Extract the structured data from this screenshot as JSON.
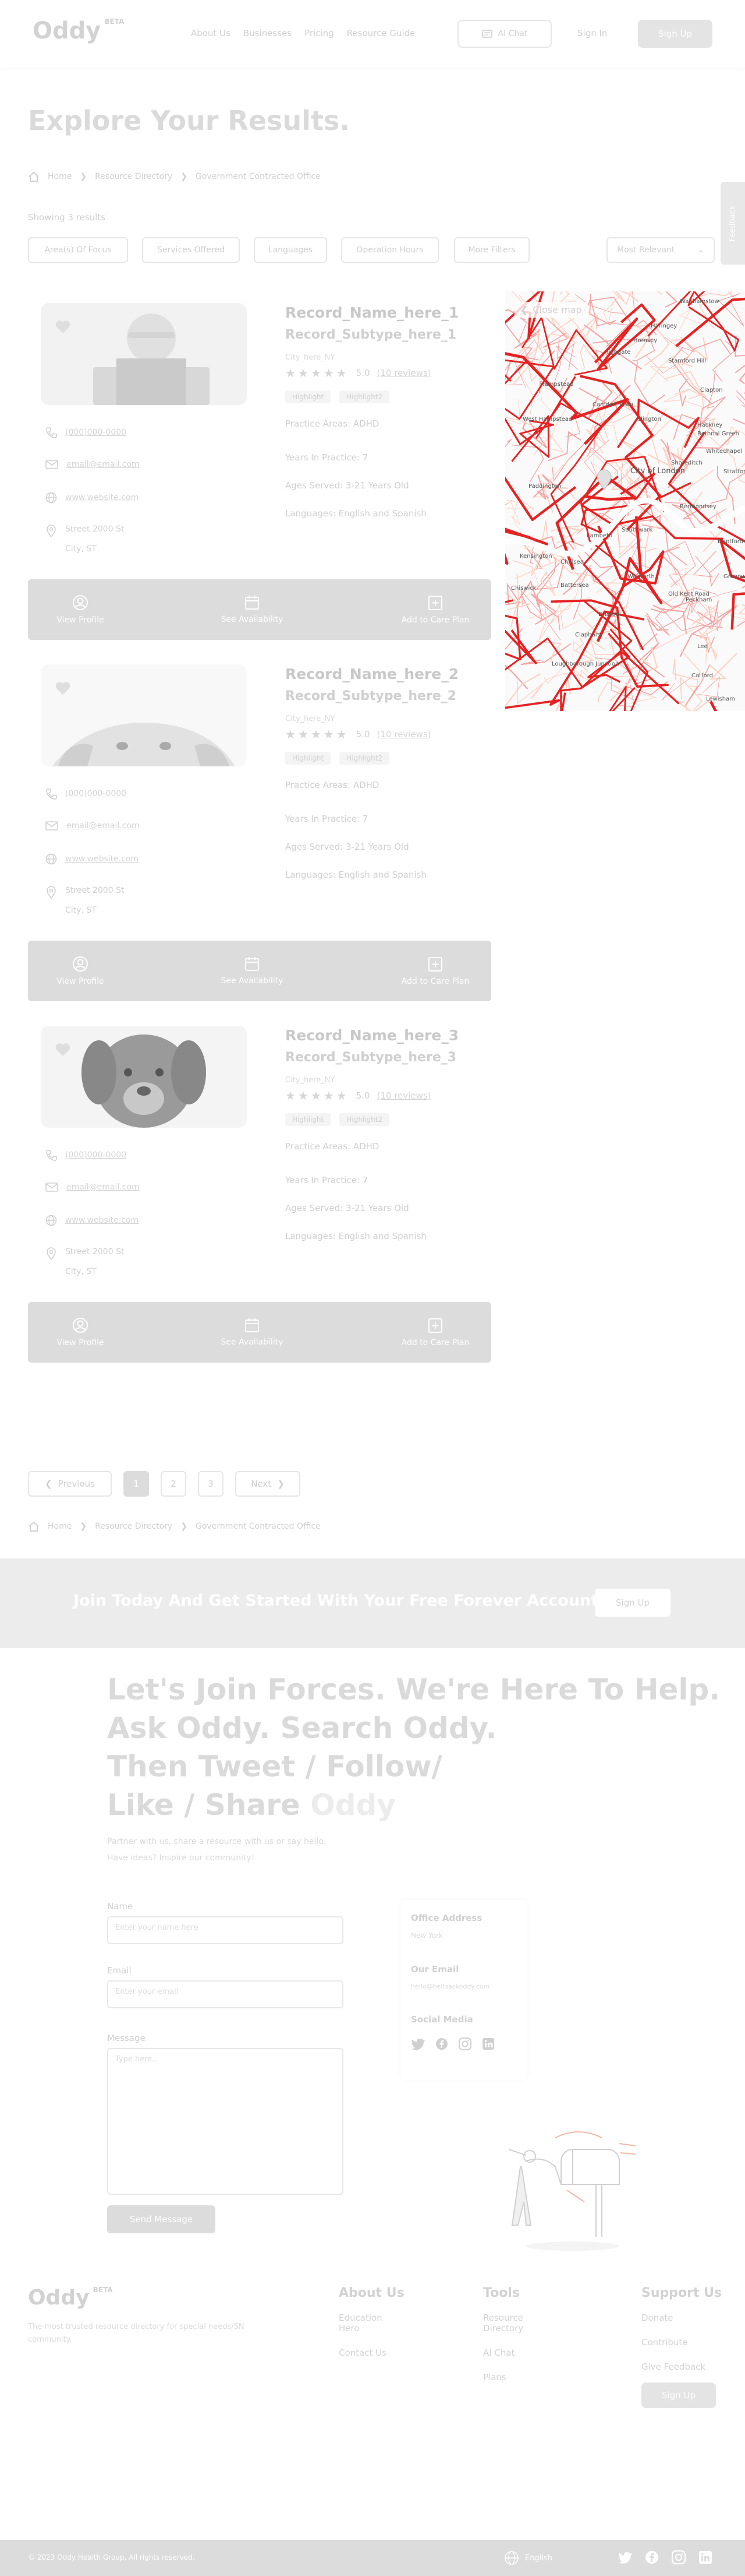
{
  "header": {
    "logo": "Oddy",
    "logo_badge": "BETA",
    "nav": [
      "About Us",
      "Businesses",
      "Pricing",
      "Resource Guide"
    ],
    "ai_chat": "AI Chat",
    "sign_in": "Sign In",
    "sign_up": "Sign Up"
  },
  "page": {
    "title": "Explore Your Results.",
    "breadcrumb": [
      "Home",
      "Resource Directory",
      "Government Contracted Office"
    ],
    "showing": "Showing 3 results",
    "filters": [
      "Area(s) Of Focus",
      "Services Offered",
      "Languages",
      "Operation Hours",
      "More Filters"
    ],
    "sort": "Most Relevant",
    "feedback_tab": "Feedback",
    "close_map": "Close map"
  },
  "map": {
    "labels": [
      "Walthamstow",
      "Haringey",
      "Hornsey",
      "Highgate",
      "Hampstead",
      "Stamford Hill",
      "West Hampstead",
      "Camden Town",
      "Islington",
      "Clapton",
      "Hackney",
      "Shoreditch",
      "Whitechapel",
      "Bethnal Green",
      "Stratford",
      "City of London",
      "Paddington",
      "Kensington",
      "Lambeth",
      "Southwark",
      "Bermondsey",
      "Greenwich",
      "Peckham",
      "Walworth",
      "Old Kent Road",
      "Brixton",
      "Clapham",
      "Battersea",
      "Chelsea",
      "Chiswick",
      "Loughborough Junction",
      "Lee",
      "Lewisham",
      "Deptford",
      "Catford"
    ]
  },
  "records": [
    {
      "name": "Record_Name_here_1",
      "subtype": "Record_Subtype_here_1",
      "city": "City_here_NY",
      "rating": "5.0",
      "reviews": "(10 reviews)",
      "tags": [
        "Highlight",
        "Highlight2"
      ],
      "practice": "Practice Areas: ADHD",
      "years": "Years In Practice: 7",
      "ages": "Ages Served: 3-21 Years Old",
      "languages": "Languages: English and Spanish",
      "phone": "(000)000-0000",
      "email": "email@email.com",
      "website": "www.website.com",
      "street": "Street 2000 St",
      "citystate": "City, ST",
      "view_profile": "View Profile",
      "availability": "See Availability",
      "care_plan": "Add to Care Plan"
    },
    {
      "name": "Record_Name_here_2",
      "subtype": "Record_Subtype_here_2",
      "city": "City_here_NY",
      "rating": "5.0",
      "reviews": "(10 reviews)",
      "tags": [
        "Highlight",
        "Highlight2"
      ],
      "practice": "Practice Areas: ADHD",
      "years": "Years In Practice: 7",
      "ages": "Ages Served: 3-21 Years Old",
      "languages": "Languages: English and Spanish",
      "phone": "(000)000-0000",
      "email": "email@email.com",
      "website": "www.website.com",
      "street": "Street 2000 St",
      "citystate": "City, ST",
      "view_profile": "View Profile",
      "availability": "See Availability",
      "care_plan": "Add to Care Plan"
    },
    {
      "name": "Record_Name_here_3",
      "subtype": "Record_Subtype_here_3",
      "city": "City_here_NY",
      "rating": "5.0",
      "reviews": "(10 reviews)",
      "tags": [
        "Highlight",
        "Highlight2"
      ],
      "practice": "Practice Areas: ADHD",
      "years": "Years In Practice: 7",
      "ages": "Ages Served: 3-21 Years Old",
      "languages": "Languages: English and Spanish",
      "phone": "(000)000-0000",
      "email": "email@email.com",
      "website": "www.website.com",
      "street": "Street 2000 St",
      "citystate": "City, ST",
      "view_profile": "View Profile",
      "availability": "See Availability",
      "care_plan": "Add to Care Plan"
    }
  ],
  "pagination": {
    "previous": "Previous",
    "pages": [
      "1",
      "2",
      "3"
    ],
    "next": "Next",
    "current": "1"
  },
  "cta": {
    "text": "Join Today And Get Started With Your Free Forever Account!",
    "button": "Sign Up"
  },
  "contact": {
    "headline": [
      "Let's Join Forces. We're Here To Help.",
      "Ask Oddy. Search Oddy.",
      "Then Tweet / Follow/",
      "Like / Share"
    ],
    "headline_accent": "Oddy",
    "sub1": "Partner with us, share a resource with us or say hello.",
    "sub2": "Have ideas? Inspire our community!",
    "name_label": "Name",
    "name_placeholder": "Enter your name here",
    "email_label": "Email",
    "email_placeholder": "Enter your email",
    "message_label": "Message",
    "message_placeholder": "Type here...",
    "send": "Send Message",
    "office_label": "Office Address",
    "office_value": "New York",
    "email_us_label": "Our Email",
    "email_us_value": "hello@helloaskoddy.com",
    "social_label": "Social Media"
  },
  "footer": {
    "logo": "Oddy",
    "badge": "BETA",
    "tagline": "The most trusted resource directory for special needs/SN community.",
    "about_title": "About Us",
    "about_links": [
      "Education Hero",
      "Contact Us"
    ],
    "tools_title": "Tools",
    "tools_links": [
      "Resource Directory",
      "AI Chat",
      "Plans"
    ],
    "support_title": "Support Us",
    "support_links": [
      "Donate",
      "Contribute",
      "Give Feedback"
    ],
    "signup": "Sign Up",
    "copyright": "© 2023 Oddy Health Group. All rights reserved.",
    "language": "English"
  }
}
